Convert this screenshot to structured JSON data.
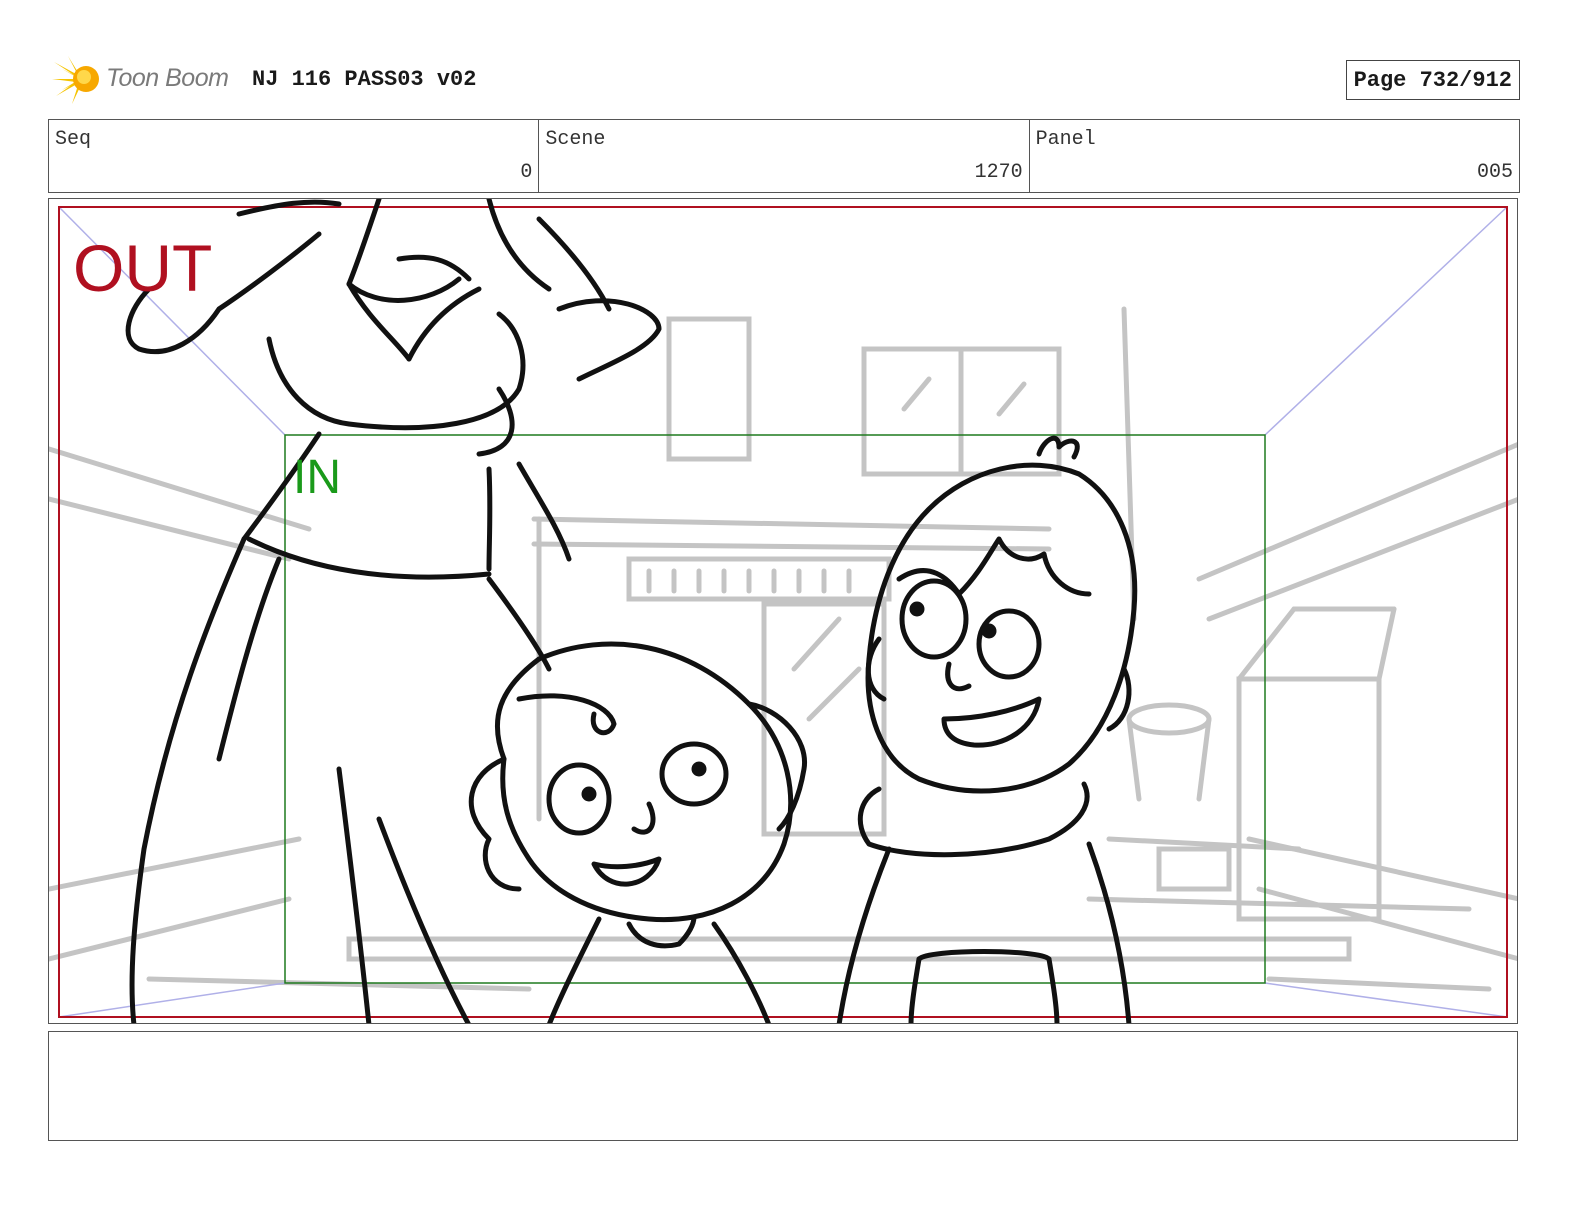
{
  "header": {
    "logo_text": "Toon Boom",
    "title": "NJ 116 PASS03 v02",
    "page_label": "Page 732/912"
  },
  "info": {
    "seq_label": "Seq",
    "seq_value": "0",
    "scene_label": "Scene",
    "scene_value": "1270",
    "panel_label": "Panel",
    "panel_value": "005"
  },
  "panel": {
    "out_label": "OUT",
    "in_label": "IN",
    "colors": {
      "out_frame": "#b01020",
      "in_frame": "#1f7a1f",
      "perspective": "#b0b0e8",
      "ink": "#111111",
      "background_sketch": "#c4c4c4"
    }
  },
  "notes": {
    "text": ""
  }
}
